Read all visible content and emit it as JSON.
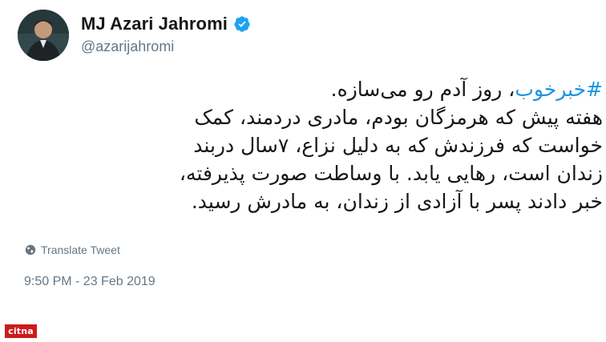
{
  "tweet": {
    "author_name": "MJ Azari Jahromi",
    "author_handle": "@azarijahromi",
    "hashtag": "#خبرخوب",
    "line1_rest": "، روز آدم رو می‌سازه.",
    "line2": "هفته پیش که هرمزگان بودم، مادری دردمند، کمک",
    "line3": "خواست که فرزندش که به دلیل نزاع، ۷سال دربند",
    "line4": "زندان است، رهایی یابد. با وساطت صورت پذیرفته،",
    "line5": "خبر دادند پسر با آزادی از زندان، به مادرش رسید.",
    "translate_label": "Translate Tweet",
    "timestamp": "9:50 PM - 23 Feb 2019"
  },
  "watermark": "citna",
  "icons": {
    "verified": "verified-badge-icon",
    "translate": "globe-icon"
  },
  "colors": {
    "hashtag": "#1b95e0",
    "verified": "#1da1f2",
    "secondary_text": "#657786",
    "watermark_bg": "#cc1b1b"
  }
}
